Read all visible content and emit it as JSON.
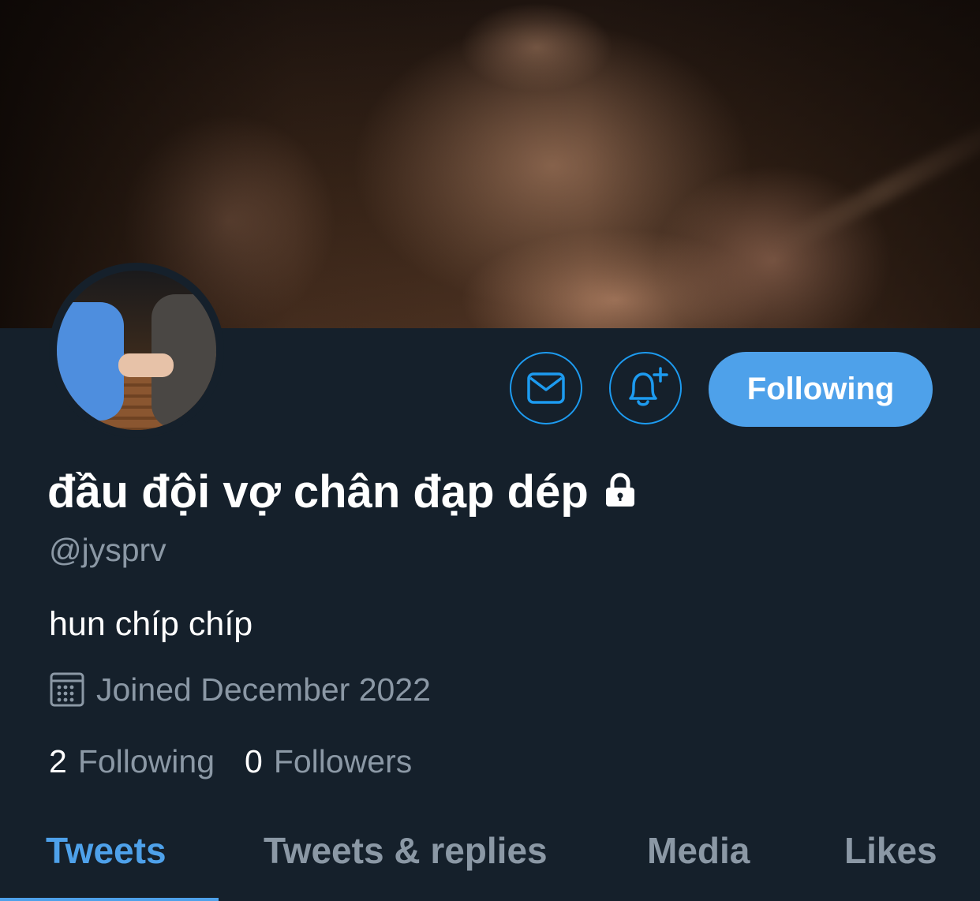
{
  "banner": {
    "image": "blurred-face-photo"
  },
  "avatar": {
    "image": "two-people-holding-hands-photo"
  },
  "actions": {
    "message_icon": "mail-icon",
    "notify_icon": "bell-plus-icon",
    "follow_label": "Following"
  },
  "profile": {
    "display_name": "đầu đội vợ chân đạp dép",
    "protected_icon": "lock-icon",
    "handle": "@jysprv",
    "bio": "hun chíp chíp",
    "joined_icon": "calendar-icon",
    "joined": "Joined December 2022"
  },
  "stats": {
    "following_count": "2",
    "following_label": "Following",
    "followers_count": "0",
    "followers_label": "Followers"
  },
  "tabs": [
    {
      "label": "Tweets",
      "active": true
    },
    {
      "label": "Tweets & replies",
      "active": false
    },
    {
      "label": "Media",
      "active": false
    },
    {
      "label": "Likes",
      "active": false
    }
  ],
  "colors": {
    "background": "#15202b",
    "accent": "#4ea1ea",
    "secondary_text": "#8b98a5"
  }
}
